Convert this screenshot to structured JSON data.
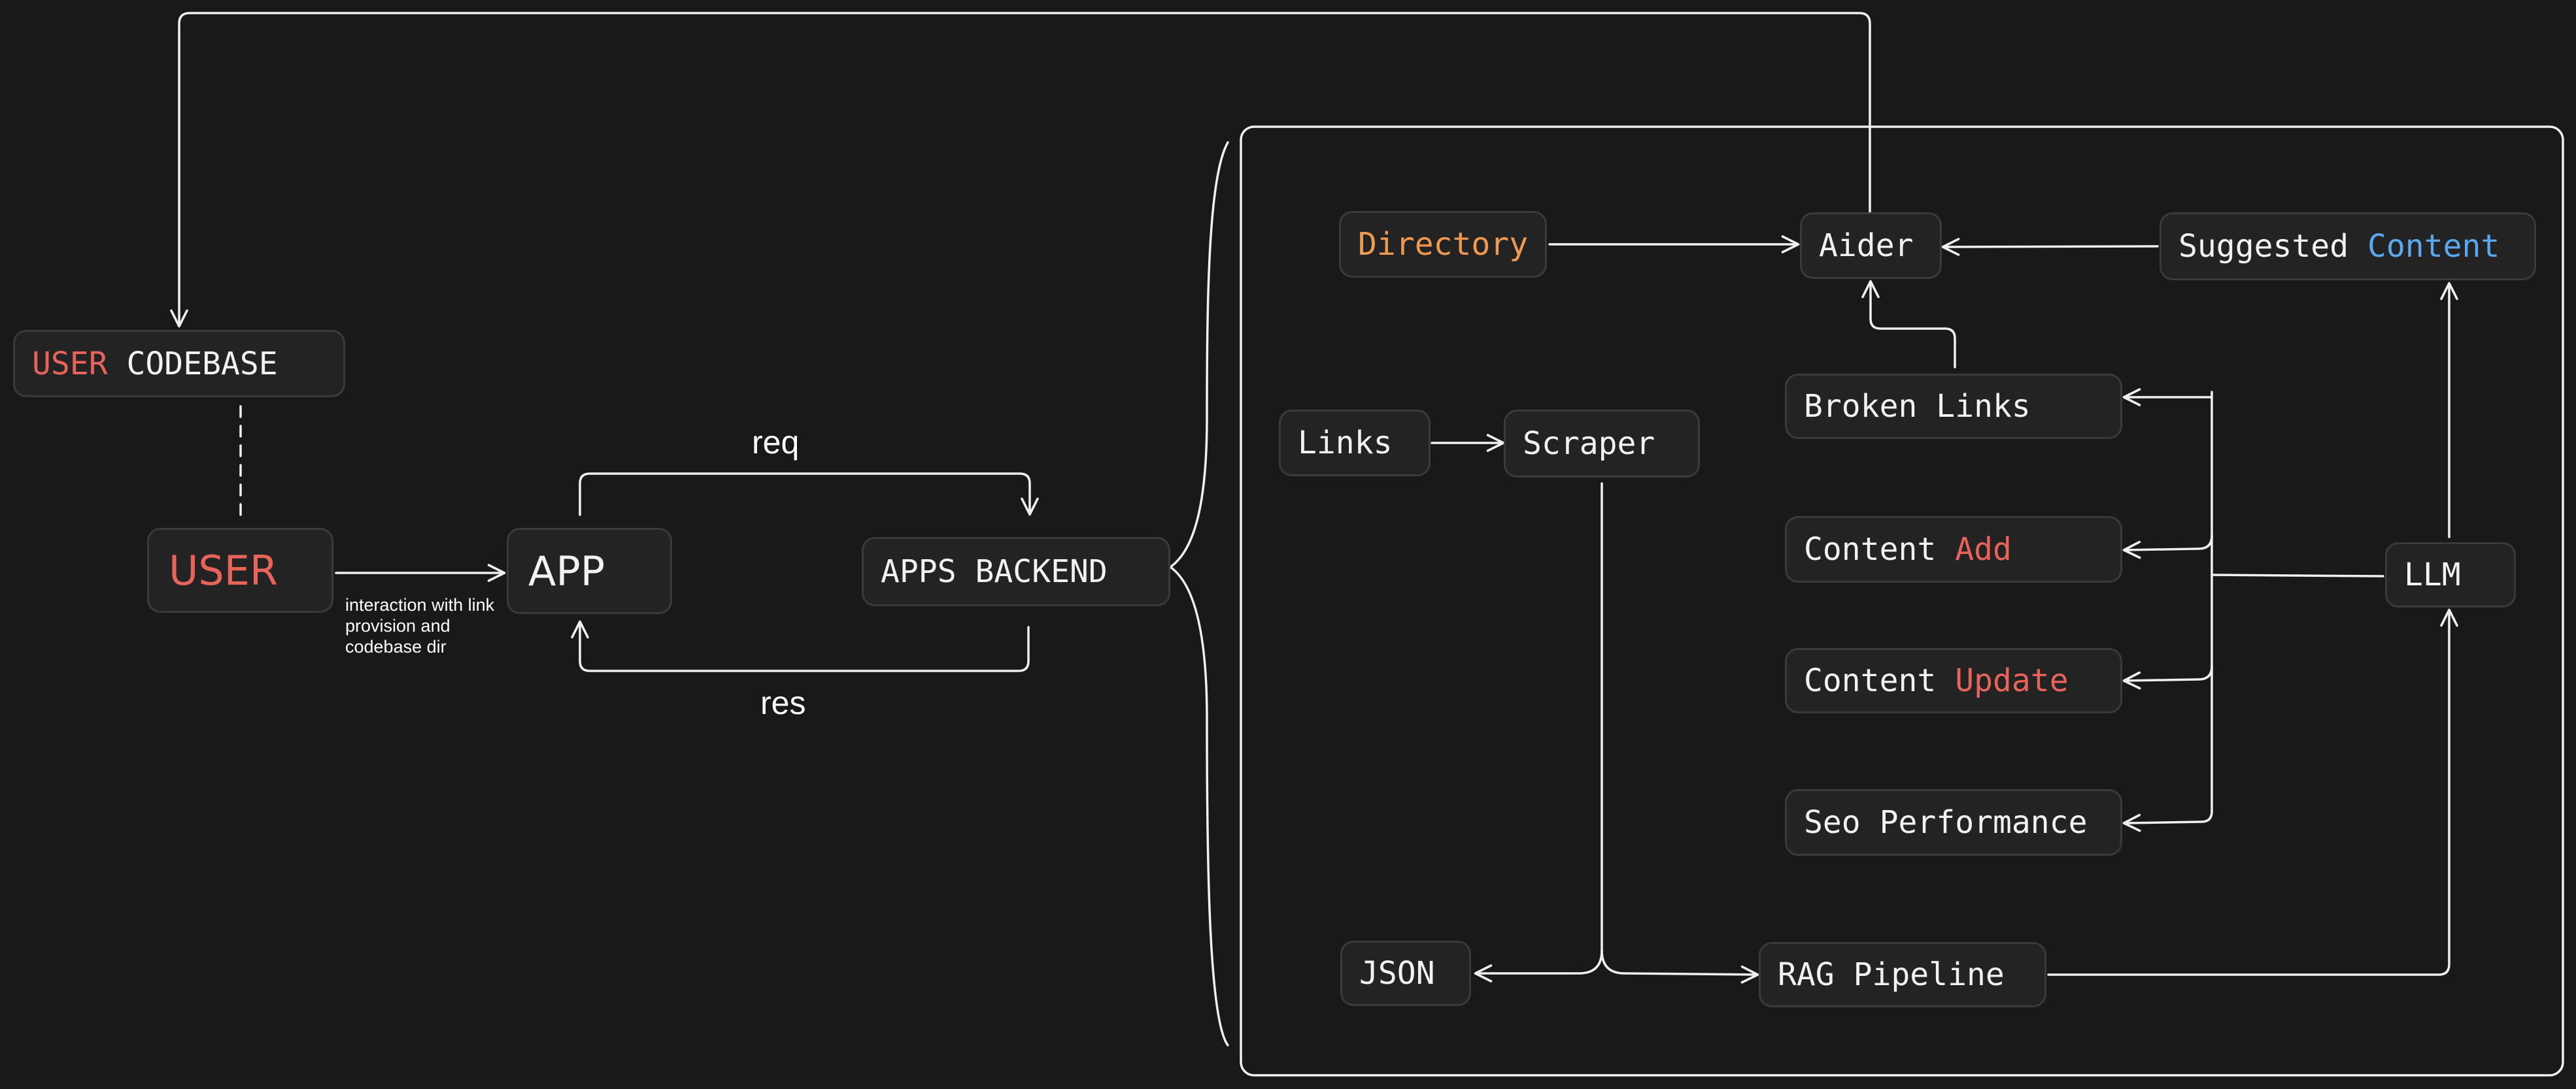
{
  "nodes": {
    "user_codebase": {
      "part1": "USER",
      "part2": "CODEBASE"
    },
    "user": {
      "label": "USER"
    },
    "app": {
      "label": "APP"
    },
    "apps_backend": {
      "label": "APPS BACKEND"
    },
    "directory": {
      "label": "Directory"
    },
    "aider": {
      "label": "Aider"
    },
    "suggested_content": {
      "part1": "Suggested",
      "part2": "Content"
    },
    "links": {
      "label": "Links"
    },
    "scraper": {
      "label": "Scraper"
    },
    "broken_links": {
      "label": "Broken Links"
    },
    "content_add": {
      "part1": "Content",
      "part2": "Add"
    },
    "content_update": {
      "part1": "Content",
      "part2": "Update"
    },
    "seo_performance": {
      "label": "Seo Performance"
    },
    "llm": {
      "label": "LLM"
    },
    "json": {
      "label": "JSON"
    },
    "rag_pipeline": {
      "label": "RAG Pipeline"
    }
  },
  "labels": {
    "req": "req",
    "res": "res",
    "interaction": [
      "interaction with link",
      "provision and",
      "codebase dir"
    ]
  },
  "colors": {
    "background": "#191919",
    "node_fill": "#232323",
    "node_border": "#3a3a3a",
    "text": "#f2f2f2",
    "highlight_red": "#e8645a",
    "highlight_orange": "#ef9a50",
    "highlight_blue": "#5aa8f0",
    "line": "#f0f0f0"
  }
}
